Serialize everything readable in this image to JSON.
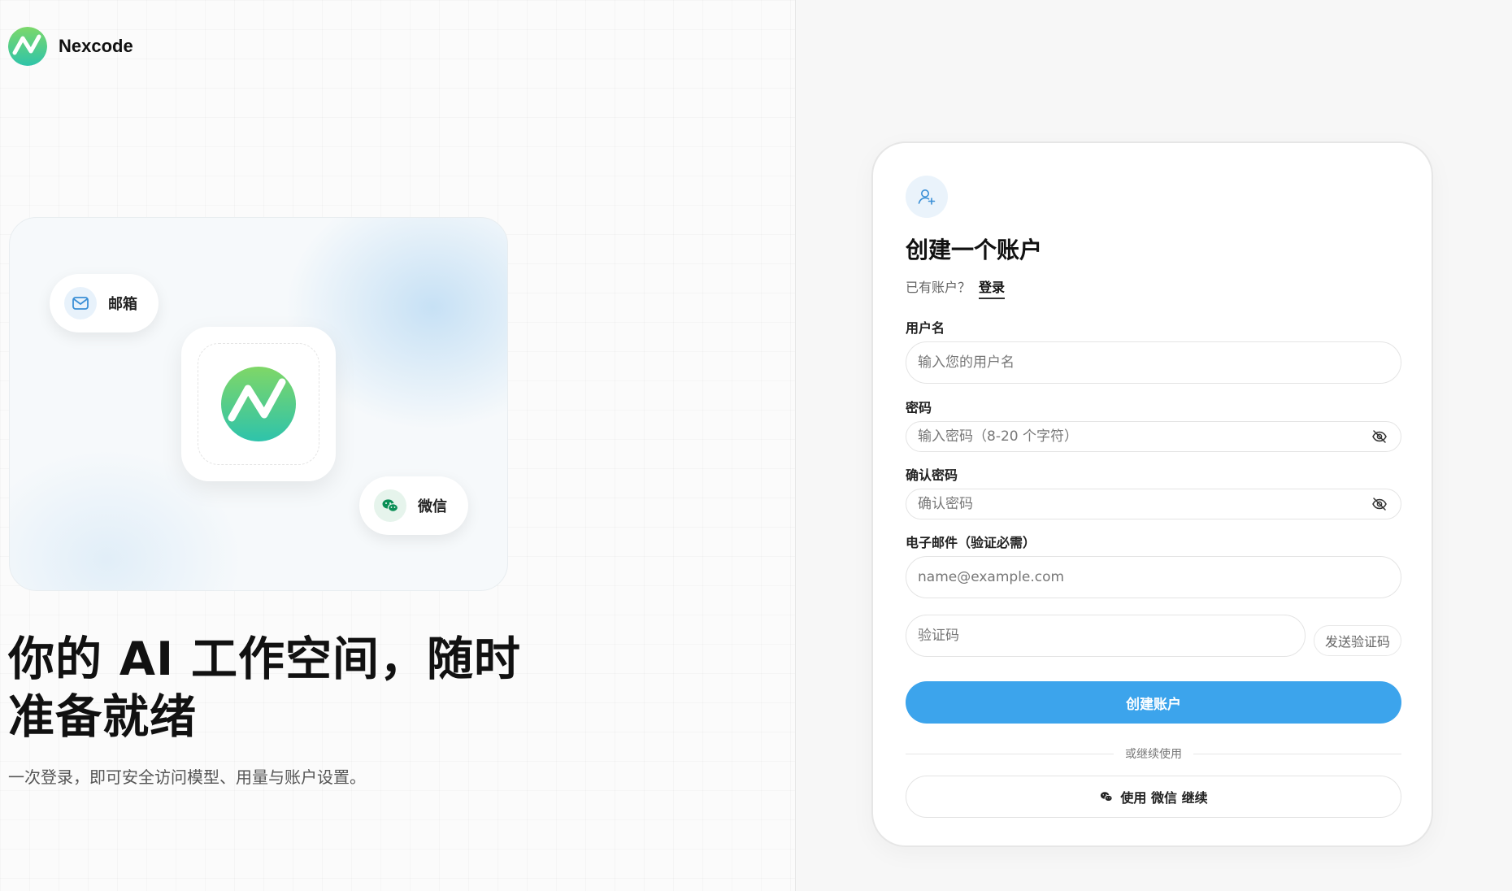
{
  "brand": {
    "name": "Nexcode",
    "logo_icon": "nexcode-logo-icon"
  },
  "hero": {
    "chips": {
      "mail_label": "邮箱",
      "wechat_label": "微信"
    },
    "headline": "你的 AI 工作空间，随时准备就绪",
    "subline": "一次登录，即可安全访问模型、用量与账户设置。"
  },
  "form": {
    "title": "创建一个账户",
    "have_account": "已有账户？",
    "login_link": "登录",
    "username": {
      "label": "用户名",
      "placeholder": "输入您的用户名",
      "value": ""
    },
    "password": {
      "label": "密码",
      "placeholder": "输入密码（8-20 个字符）",
      "value": ""
    },
    "confirm_password": {
      "label": "确认密码",
      "placeholder": "确认密码",
      "value": ""
    },
    "email": {
      "label": "电子邮件（验证必需）",
      "placeholder": "name@example.com",
      "value": ""
    },
    "code": {
      "placeholder": "验证码",
      "value": "",
      "send_label": "发送验证码"
    },
    "submit_label": "创建账户",
    "divider_text": "或继续使用",
    "wechat_continue_label": "使用 微信 继续"
  },
  "colors": {
    "accent": "#3ca4ec",
    "logo_green_top": "#6fd36a",
    "logo_green_bottom": "#33c5a8",
    "wechat_green": "#0a8f56"
  }
}
